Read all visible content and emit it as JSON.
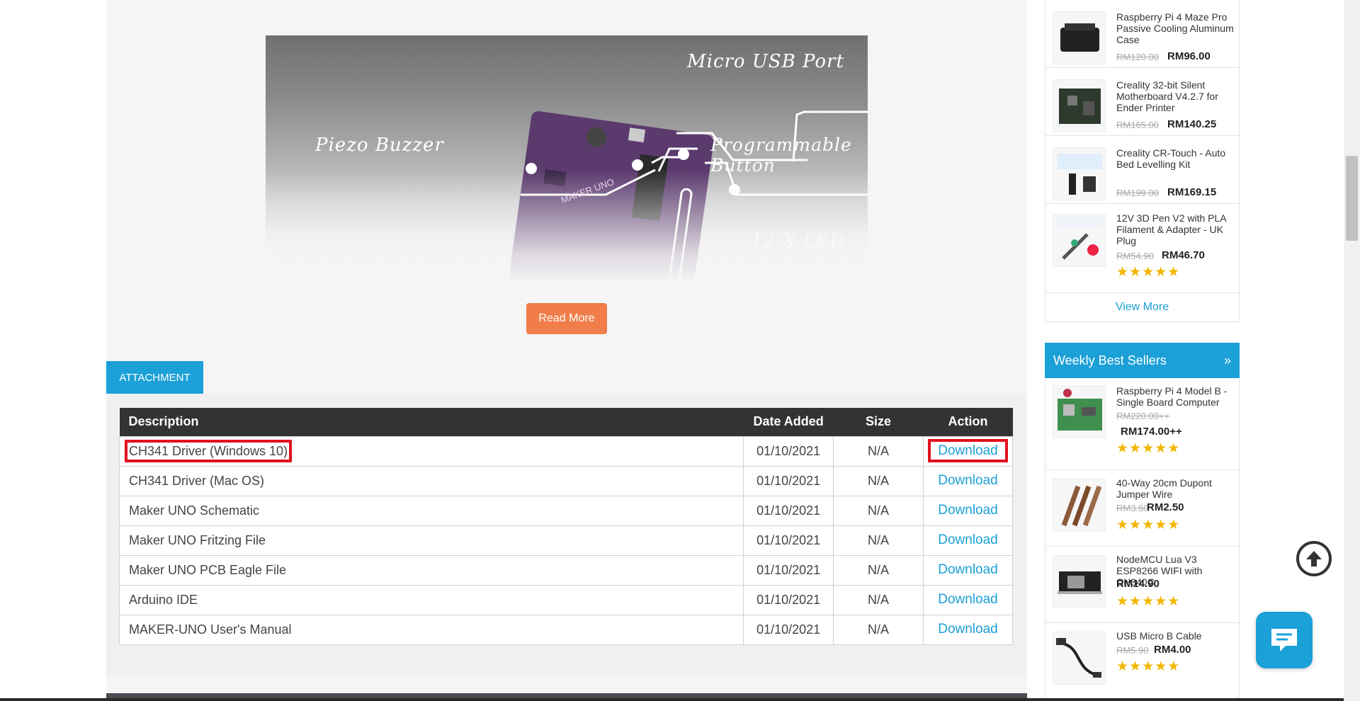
{
  "hero": {
    "labels": {
      "micro_usb": "Micro USB Port",
      "piezo": "Piezo Buzzer",
      "button": "Programmable Button",
      "led": "12 X LED",
      "board_text": "MAKER UNO"
    },
    "read_more": "Read More"
  },
  "attachment": {
    "tab_label": "ATTACHMENT",
    "headers": {
      "description": "Description",
      "date": "Date Added",
      "size": "Size",
      "action": "Action"
    },
    "rows": [
      {
        "description": "CH341 Driver (Windows 10)",
        "date": "01/10/2021",
        "size": "N/A",
        "action": "Download"
      },
      {
        "description": "CH341 Driver (Mac OS)",
        "date": "01/10/2021",
        "size": "N/A",
        "action": "Download"
      },
      {
        "description": "Maker UNO Schematic",
        "date": "01/10/2021",
        "size": "N/A",
        "action": "Download"
      },
      {
        "description": "Maker UNO Fritzing File",
        "date": "01/10/2021",
        "size": "N/A",
        "action": "Download"
      },
      {
        "description": "Maker UNO PCB Eagle File",
        "date": "01/10/2021",
        "size": "N/A",
        "action": "Download"
      },
      {
        "description": "Arduino IDE",
        "date": "01/10/2021",
        "size": "N/A",
        "action": "Download"
      },
      {
        "description": "MAKER-UNO User's Manual",
        "date": "01/10/2021",
        "size": "N/A",
        "action": "Download"
      }
    ]
  },
  "sidebar": {
    "top_products": [
      {
        "name": "Raspberry Pi 4 Maze Pro Passive Cooling Aluminum Case",
        "old_price": "RM120.00",
        "price": "RM96.00",
        "rating": 0,
        "icon": "aluminum-case-image"
      },
      {
        "name": "Creality 32-bit Silent Motherboard V4.2.7 for Ender Printer",
        "old_price": "RM165.00",
        "price": "RM140.25",
        "rating": 0,
        "icon": "motherboard-image"
      },
      {
        "name": "Creality CR-Touch - Auto Bed Levelling Kit",
        "old_price": "RM199.00",
        "price": "RM169.15",
        "rating": 0,
        "icon": "cr-touch-image"
      },
      {
        "name": "12V 3D Pen V2 with PLA Filament & Adapter - UK Plug",
        "old_price": "RM54.90",
        "price": "RM46.70",
        "rating": 5,
        "icon": "3d-pen-image"
      }
    ],
    "view_more": "View More",
    "weekly_title": "Weekly Best Sellers",
    "weekly_products": [
      {
        "name": "Raspberry Pi 4 Model B - Single Board Computer",
        "old_price": "RM220.00++",
        "price": "RM174.00++",
        "rating": 5,
        "icon": "raspberry-pi-image"
      },
      {
        "name": "40-Way 20cm Dupont Jumper Wire",
        "old_price": "RM3.60",
        "price": "RM2.50",
        "rating": 5,
        "icon": "jumper-wire-image"
      },
      {
        "name": "NodeMCU Lua V3 ESP8266 WIFI with CH340C",
        "old_price": "",
        "price": "RM14.90",
        "rating": 5,
        "icon": "nodemcu-image"
      },
      {
        "name": "USB Micro B Cable",
        "old_price": "RM5.90",
        "price": "RM4.00",
        "rating": 5,
        "icon": "usb-cable-image"
      }
    ],
    "stars": "★★★★★"
  },
  "colors": {
    "accent": "#1ba0d8",
    "orange": "#f07d4a",
    "highlight": "#e0101f"
  }
}
